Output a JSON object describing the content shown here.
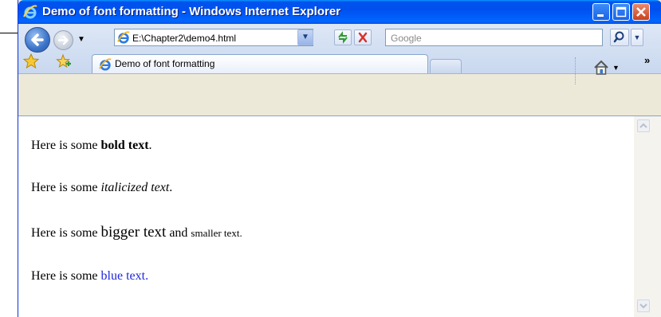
{
  "window": {
    "title": "Demo of font formatting - Windows Internet Explorer"
  },
  "nav": {
    "address": "E:\\Chapter2\\demo4.html",
    "search_placeholder": "Google"
  },
  "tabs": [
    {
      "label": "Demo of font formatting"
    }
  ],
  "content": {
    "p1": {
      "prefix": "Here is some ",
      "emph": "bold text",
      "suffix": "."
    },
    "p2": {
      "prefix": "Here is some ",
      "emph": "italicized text",
      "suffix": "."
    },
    "p3": {
      "prefix": "Here is some ",
      "big": "bigger text",
      "middle": " and ",
      "small": "smaller text",
      "suffix": "."
    },
    "p4": {
      "prefix": "Here is some ",
      "colored": "blue text",
      "suffix": "."
    }
  },
  "colors": {
    "titlebar": "#0053ee",
    "link_blue": "#1f27d8"
  },
  "icons": [
    "ie-icon",
    "back-arrow-icon",
    "forward-arrow-icon",
    "refresh-icon",
    "stop-icon",
    "search-icon",
    "star-icon",
    "add-favorite-icon",
    "home-icon"
  ]
}
